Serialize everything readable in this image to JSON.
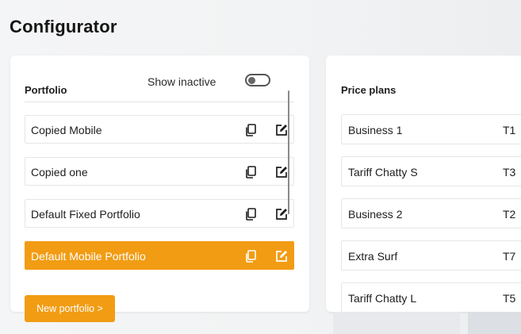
{
  "page": {
    "title": "Configurator"
  },
  "portfolio": {
    "title": "Portfolio",
    "show_inactive_label": "Show inactive",
    "show_inactive_on": false,
    "items": [
      {
        "label": "Copied Mobile",
        "selected": false
      },
      {
        "label": "Copied one",
        "selected": false
      },
      {
        "label": "Default Fixed Portfolio",
        "selected": false
      },
      {
        "label": "Default Mobile Portfolio",
        "selected": true
      }
    ],
    "new_button_label": "New portfolio >"
  },
  "price_plans": {
    "title": "Price plans",
    "rows": [
      {
        "name": "Business 1",
        "code": "T1"
      },
      {
        "name": "Tariff Chatty S",
        "code": "T3"
      },
      {
        "name": "Business 2",
        "code": "T2"
      },
      {
        "name": "Extra Surf",
        "code": "T7"
      },
      {
        "name": "Tariff Chatty L",
        "code": "T5"
      }
    ]
  },
  "icons": {
    "copy": "copy-icon",
    "edit": "edit-icon"
  },
  "colors": {
    "accent": "#f29c13",
    "text": "#1d1d1f"
  }
}
